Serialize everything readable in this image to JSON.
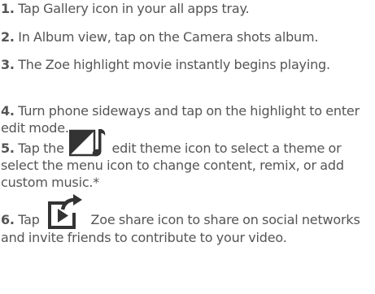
{
  "steps": [
    {
      "num": "1.",
      "text": "Tap Gallery icon in your all apps tray."
    },
    {
      "num": "2.",
      "text": "In Album view, tap on the Camera shots album."
    },
    {
      "num": "3.",
      "text": "The Zoe highlight movie instantly begins playing."
    },
    {
      "num": "4.",
      "text": "Turn phone sideways and tap on the highlight to enter edit mode."
    },
    {
      "num": "5.",
      "text_before": "Tap the",
      "text_after": "edit theme icon to select a theme or select the menu icon to change content, remix, or add custom music.*"
    },
    {
      "num": "6.",
      "text_before": "Tap",
      "text_after": "Zoe share icon to share on social networks and invite friends to contribute to your video."
    }
  ],
  "icons": {
    "theme": "edit-theme-icon",
    "share": "zoe-share-icon"
  },
  "colors": {
    "text": "#555555",
    "icon": "#333333"
  }
}
